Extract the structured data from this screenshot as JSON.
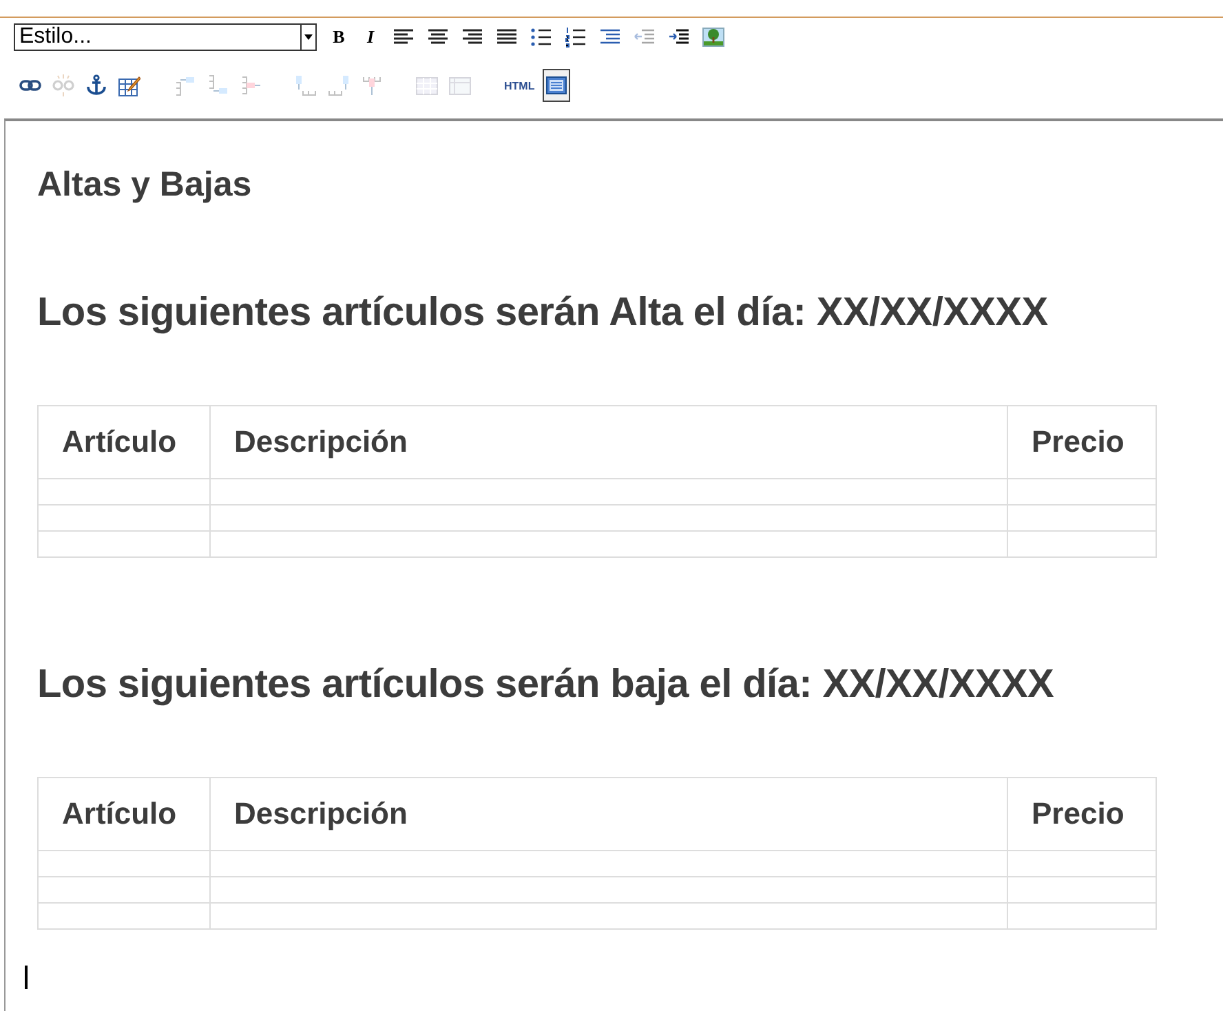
{
  "toolbar": {
    "style_select": {
      "value": "Estilo..."
    },
    "rows": [
      [
        {
          "kind": "bold",
          "label": "B",
          "disabled": false
        },
        {
          "kind": "italic",
          "label": "I",
          "disabled": false
        },
        {
          "kind": "align-left",
          "disabled": false
        },
        {
          "kind": "align-center",
          "disabled": false
        },
        {
          "kind": "align-right",
          "disabled": false
        },
        {
          "kind": "justify",
          "disabled": false
        },
        {
          "kind": "bullet-list",
          "disabled": false
        },
        {
          "kind": "numbered-list",
          "disabled": false
        },
        {
          "kind": "indent-lines",
          "disabled": false
        },
        {
          "kind": "outdent",
          "disabled": true
        },
        {
          "kind": "indent",
          "disabled": false
        },
        {
          "kind": "image",
          "disabled": false
        }
      ],
      [
        {
          "kind": "link",
          "disabled": false
        },
        {
          "kind": "unlink",
          "disabled": true
        },
        {
          "kind": "anchor",
          "disabled": false
        },
        {
          "kind": "table-edit",
          "disabled": false
        },
        {
          "kind": "row-before",
          "disabled": true
        },
        {
          "kind": "row-after",
          "disabled": true
        },
        {
          "kind": "row-delete",
          "disabled": true
        },
        {
          "kind": "col-before",
          "disabled": true
        },
        {
          "kind": "col-after",
          "disabled": true
        },
        {
          "kind": "col-delete",
          "disabled": true
        },
        {
          "kind": "table-grid",
          "disabled": true
        },
        {
          "kind": "table-props",
          "disabled": true
        },
        {
          "kind": "html",
          "label": "HTML",
          "disabled": false
        },
        {
          "kind": "design-view",
          "disabled": false,
          "selected": true
        }
      ]
    ]
  },
  "document": {
    "title": "Altas y Bajas",
    "sections": [
      {
        "heading": "Los siguientes artículos serán Alta el día: XX/XX/XXXX",
        "columns": [
          "Artículo",
          "Descripción",
          "Precio"
        ]
      },
      {
        "heading": "Los siguientes artículos serán baja el día: XX/XX/XXXX",
        "columns": [
          "Artículo",
          "Descripción",
          "Precio"
        ]
      }
    ]
  }
}
